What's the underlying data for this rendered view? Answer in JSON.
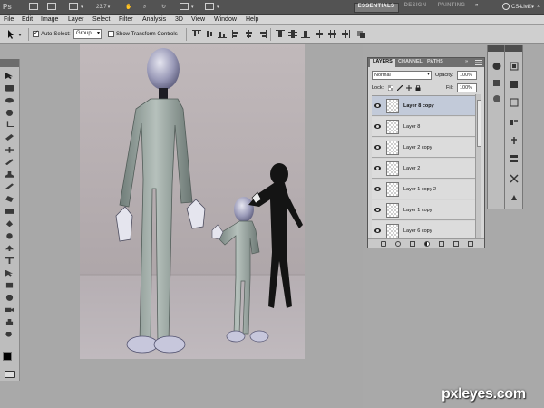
{
  "app": {
    "logo": "Ps",
    "zoom": "23.7",
    "workspaces": [
      "ESSENTIALS",
      "DESIGN",
      "PAINTING"
    ],
    "workspace_more": "»",
    "cs_live": "CS Live",
    "window_buttons": [
      "–",
      "□",
      "×"
    ]
  },
  "menu": [
    "File",
    "Edit",
    "Image",
    "Layer",
    "Select",
    "Filter",
    "Analysis",
    "3D",
    "View",
    "Window",
    "Help"
  ],
  "options": {
    "auto_select_label": "Auto-Select:",
    "auto_select_checked": true,
    "auto_select_target": "Group",
    "show_transform_label": "Show Transform Controls",
    "show_transform_checked": false
  },
  "tools": [
    "move-tool",
    "marquee-tool",
    "lasso-tool",
    "quick-selection-tool",
    "crop-tool",
    "eyedropper-tool",
    "healing-brush-tool",
    "brush-tool",
    "clone-stamp-tool",
    "history-brush-tool",
    "eraser-tool",
    "gradient-tool",
    "blur-tool",
    "dodge-tool",
    "pen-tool",
    "type-tool",
    "path-selection-tool",
    "shape-tool",
    "3d-rotate-tool",
    "3d-camera-tool",
    "hand-tool",
    "zoom-tool"
  ],
  "colors": {
    "foreground": "#000000",
    "background": "#ffffff",
    "selection_highlight": "#c2cad9"
  },
  "layers_panel": {
    "tabs": [
      "LAYERS",
      "CHANNEL",
      "PATHS"
    ],
    "tab_more": "»",
    "blend_mode": "Normal",
    "opacity_label": "Opacity:",
    "opacity_value": "100%",
    "lock_label": "Lock:",
    "fill_label": "Fill:",
    "fill_value": "100%",
    "layers": [
      {
        "name": "Layer 8 copy",
        "selected": true
      },
      {
        "name": "Layer 8",
        "selected": false
      },
      {
        "name": "Layer 2 copy",
        "selected": false
      },
      {
        "name": "Layer 2",
        "selected": false
      },
      {
        "name": "Layer 1 copy 2",
        "selected": false
      },
      {
        "name": "Layer 1 copy",
        "selected": false
      },
      {
        "name": "Layer 6 copy",
        "selected": false
      }
    ]
  },
  "watermark": "pxleyes.com"
}
